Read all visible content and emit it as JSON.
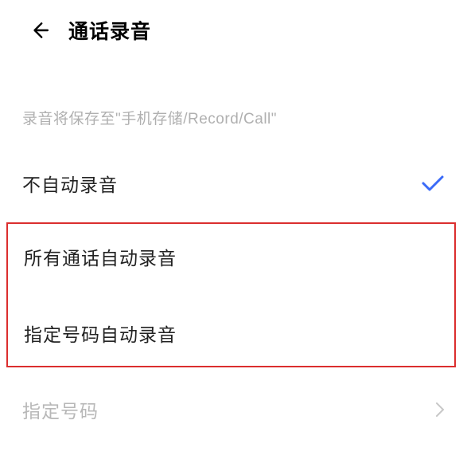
{
  "header": {
    "title": "通话录音"
  },
  "hint": "录音将保存至\"手机存储/Record/Call\"",
  "options": {
    "no_auto": "不自动录音",
    "all_calls": "所有通话自动录音",
    "specific_numbers": "指定号码自动录音"
  },
  "specified_numbers_label": "指定号码"
}
